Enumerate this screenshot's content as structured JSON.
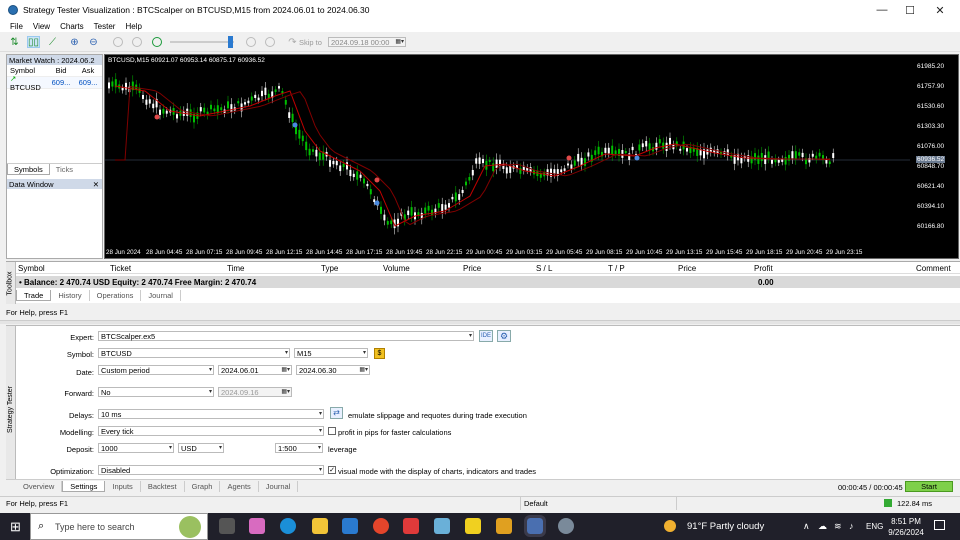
{
  "window": {
    "title": "Strategy Tester Visualization : BTCScalper on BTCUSD,M15 from 2024.06.01 to 2024.06.30",
    "min": "—",
    "max": "☐",
    "close": "✕"
  },
  "menu": [
    "File",
    "View",
    "Charts",
    "Tester",
    "Help"
  ],
  "toolbar": {
    "skip_label": "Skip to",
    "skip_date": "2024.09.18 00:00",
    "speed": 0.93
  },
  "market_watch": {
    "title": "Market Watch : 2024.06.2",
    "cols": [
      "Symbol",
      "Bid",
      "Ask"
    ],
    "row": {
      "symbol": "BTCUSD",
      "bid": "609...",
      "ask": "609..."
    },
    "tabs": [
      "Symbols",
      "Ticks"
    ],
    "data_window": "Data Window"
  },
  "chart": {
    "info": "BTCUSD,M15  60921.07 60953.14 60875.17 60936.52",
    "price_label": "60936.52",
    "y_ticks": [
      "61985.20",
      "61757.90",
      "61530.60",
      "61303.30",
      "61076.00",
      "60848.70",
      "60621.40",
      "60394.10",
      "60166.80"
    ],
    "x_ticks": [
      "28 Jun 2024",
      "28 Jun 04:45",
      "28 Jun 07:15",
      "28 Jun 09:45",
      "28 Jun 12:15",
      "28 Jun 14:45",
      "28 Jun 17:15",
      "28 Jun 19:45",
      "28 Jun 22:15",
      "29 Jun 00:45",
      "29 Jun 03:15",
      "29 Jun 05:45",
      "29 Jun 08:15",
      "29 Jun 10:45",
      "29 Jun 13:15",
      "29 Jun 15:45",
      "29 Jun 18:15",
      "29 Jun 20:45",
      "29 Jun 23:15"
    ],
    "colors": {
      "bull": "#00c000",
      "bear": "#ffffff",
      "ma_fast": "#c00000",
      "ma_slow": "#800000",
      "bg": "#000000"
    }
  },
  "trade_table": {
    "cols": [
      "Symbol",
      "Ticket",
      "Time",
      "Type",
      "Volume",
      "Price",
      "S / L",
      "T / P",
      "Price",
      "Profit",
      "Comment"
    ],
    "balance": "Balance: 2 470.74 USD  Equity: 2 470.74  Free Margin: 2 470.74",
    "profit": "0.00",
    "side_label": "Toolbox"
  },
  "toolbox_tabs": [
    "Trade",
    "History",
    "Operations",
    "Journal"
  ],
  "status1": "For Help, press F1",
  "tester": {
    "side_label": "Strategy Tester",
    "expert_label": "Expert:",
    "expert": "BTCScalper.ex5",
    "ide": "IDE",
    "symbol_label": "Symbol:",
    "symbol": "BTCUSD",
    "period": "M15",
    "date_label": "Date:",
    "date_mode": "Custom period",
    "date_from": "2024.06.01",
    "date_to": "2024.06.30",
    "forward_label": "Forward:",
    "forward": "No",
    "forward_date": "2024.09.16",
    "delays_label": "Delays:",
    "delays": "10 ms",
    "delays_note": "emulate slippage and requotes during trade execution",
    "modelling_label": "Modelling:",
    "modelling": "Every tick",
    "modelling_note": "profit in pips for faster calculations",
    "deposit_label": "Deposit:",
    "deposit": "1000",
    "currency": "USD",
    "leverage": "1:500",
    "leverage_note": "leverage",
    "optim_label": "Optimization:",
    "optim": "Disabled",
    "visual_note": "visual mode with the display of charts, indicators and trades",
    "tabs": [
      "Overview",
      "Settings",
      "Inputs",
      "Backtest",
      "Graph",
      "Agents",
      "Journal"
    ],
    "timer": "00:00:45 / 00:00:45",
    "start": "Start"
  },
  "status2": {
    "help": "For Help, press F1",
    "profile": "Default",
    "ping": "122.84 ms"
  },
  "taskbar": {
    "search": "Type here to search",
    "weather": "91°F  Partly cloudy",
    "lang": "ENG",
    "time": "8:51 PM",
    "date": "9/26/2024"
  }
}
